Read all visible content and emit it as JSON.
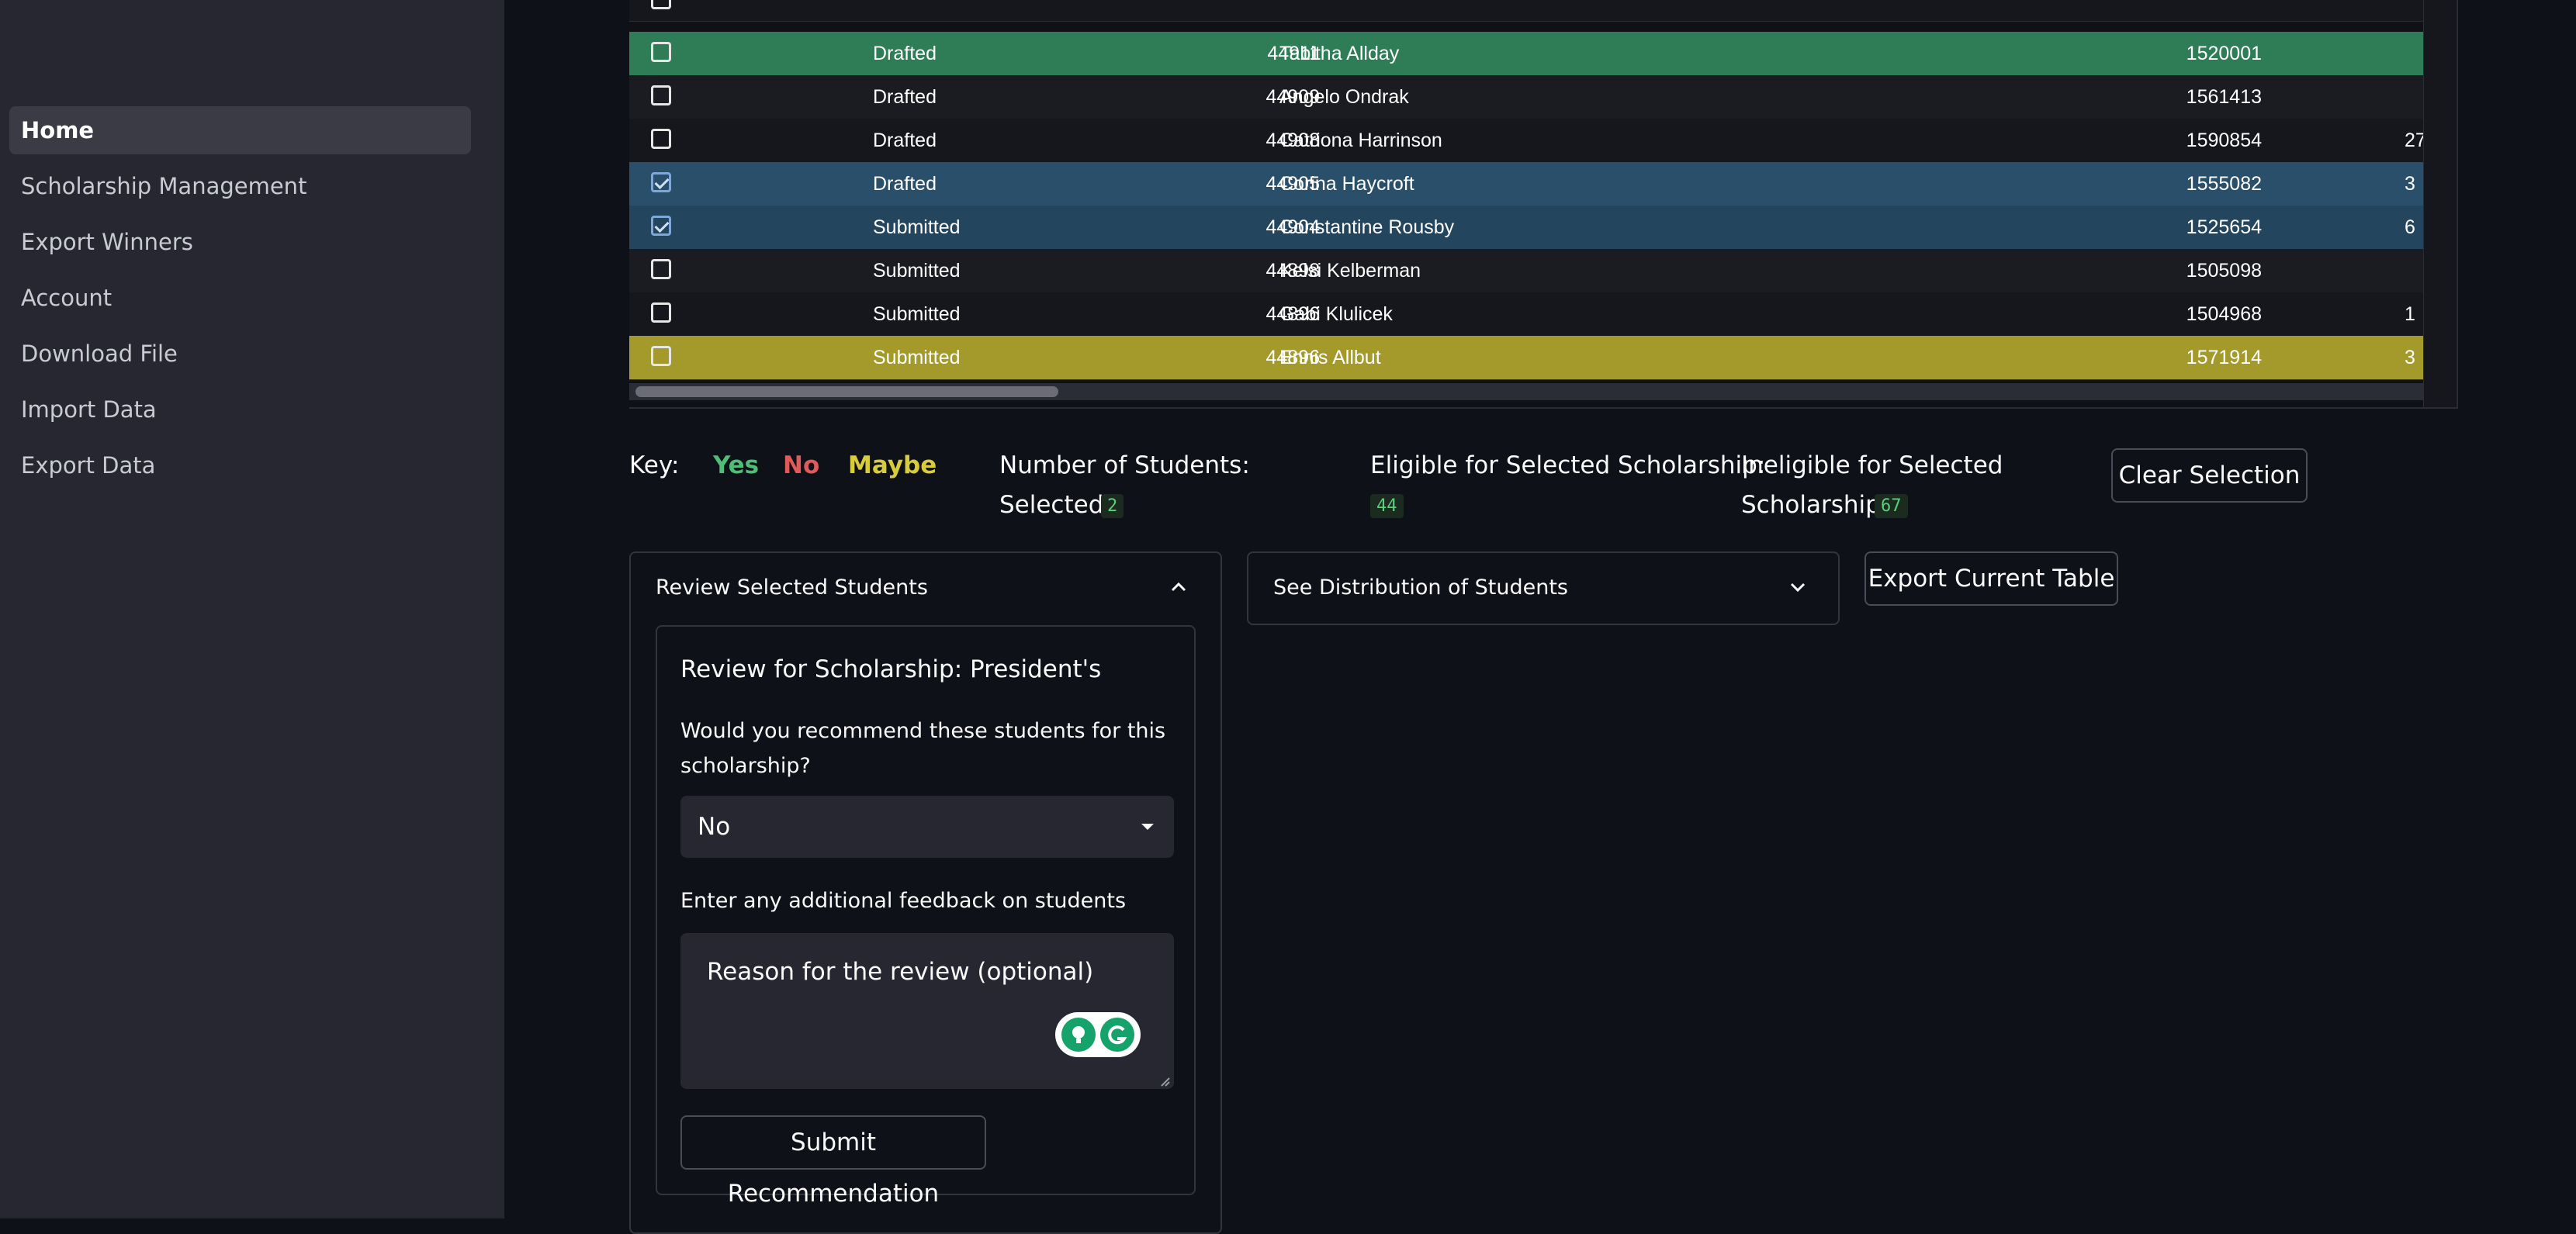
{
  "sidebar": {
    "items": [
      {
        "label": "Home",
        "active": true
      },
      {
        "label": "Scholarship Management"
      },
      {
        "label": "Export Winners"
      },
      {
        "label": "Account"
      },
      {
        "label": "Download File"
      },
      {
        "label": "Import Data"
      },
      {
        "label": "Export Data"
      }
    ]
  },
  "table": {
    "rows": [
      {
        "status": "Drafted",
        "id": "44911",
        "name": "Tabitha Allday",
        "number": "1520001",
        "extra": "",
        "checked": false,
        "highlight": "yes",
        "bg": "#2e7d57"
      },
      {
        "status": "Drafted",
        "id": "44909",
        "name": "Angelo Ondrak",
        "number": "1561413",
        "extra": "",
        "checked": false,
        "highlight": "none",
        "bg": "#1a1c22"
      },
      {
        "status": "Drafted",
        "id": "44908",
        "name": "Catriona Harrinson",
        "number": "1590854",
        "extra": "27",
        "checked": false,
        "highlight": "none",
        "bg": "#15171c"
      },
      {
        "status": "Drafted",
        "id": "44905",
        "name": "Corina Haycroft",
        "number": "1555082",
        "extra": "3",
        "checked": true,
        "highlight": "selected",
        "bg": "#2a4f6b"
      },
      {
        "status": "Submitted",
        "id": "44904",
        "name": "Constantine Rousby",
        "number": "1525654",
        "extra": "6",
        "checked": true,
        "highlight": "selected",
        "bg": "#24455e"
      },
      {
        "status": "Submitted",
        "id": "44898",
        "name": "Kelsi Kelberman",
        "number": "1505098",
        "extra": "",
        "checked": false,
        "highlight": "none",
        "bg": "#1a1c22"
      },
      {
        "status": "Submitted",
        "id": "44896",
        "name": "Gabi Klulicek",
        "number": "1504968",
        "extra": "1",
        "checked": false,
        "highlight": "none",
        "bg": "#15171c"
      },
      {
        "status": "Submitted",
        "id": "44896",
        "name": "Ennis Allbut",
        "number": "1571914",
        "extra": "3",
        "checked": false,
        "highlight": "maybe",
        "bg": "#a39a2b"
      }
    ]
  },
  "key": {
    "label": "Key:",
    "yes": "Yes",
    "no": "No",
    "maybe": "Maybe"
  },
  "stats": {
    "students_line1": "Number of Students",
    "students_line2": "Selected:",
    "students_value": "2",
    "eligible_label": "Eligible for Selected Scholarship:",
    "eligible_value": "44",
    "ineligible_line1": "Ineligible for Selected",
    "ineligible_line2": "Scholarship:",
    "ineligible_value": "67"
  },
  "buttons": {
    "clear_selection": "Clear Selection",
    "export_table": "Export Current Table",
    "submit": "Submit Recommendation"
  },
  "review": {
    "expander_title": "Review Selected Students",
    "heading": "Review for Scholarship: President's",
    "question_line1": "Would you recommend these students for this",
    "question_line2": "scholarship?",
    "selected_option": "No",
    "feedback_label": "Enter any additional feedback on students",
    "feedback_placeholder": "Reason for the review (optional)"
  },
  "distribution": {
    "expander_title": "See Distribution of Students"
  },
  "colors": {
    "accent_yes": "#4fbf78",
    "accent_no": "#e05a5a",
    "accent_maybe": "#d9cc3a",
    "background": "#0e1117",
    "sidebar": "#262730"
  }
}
